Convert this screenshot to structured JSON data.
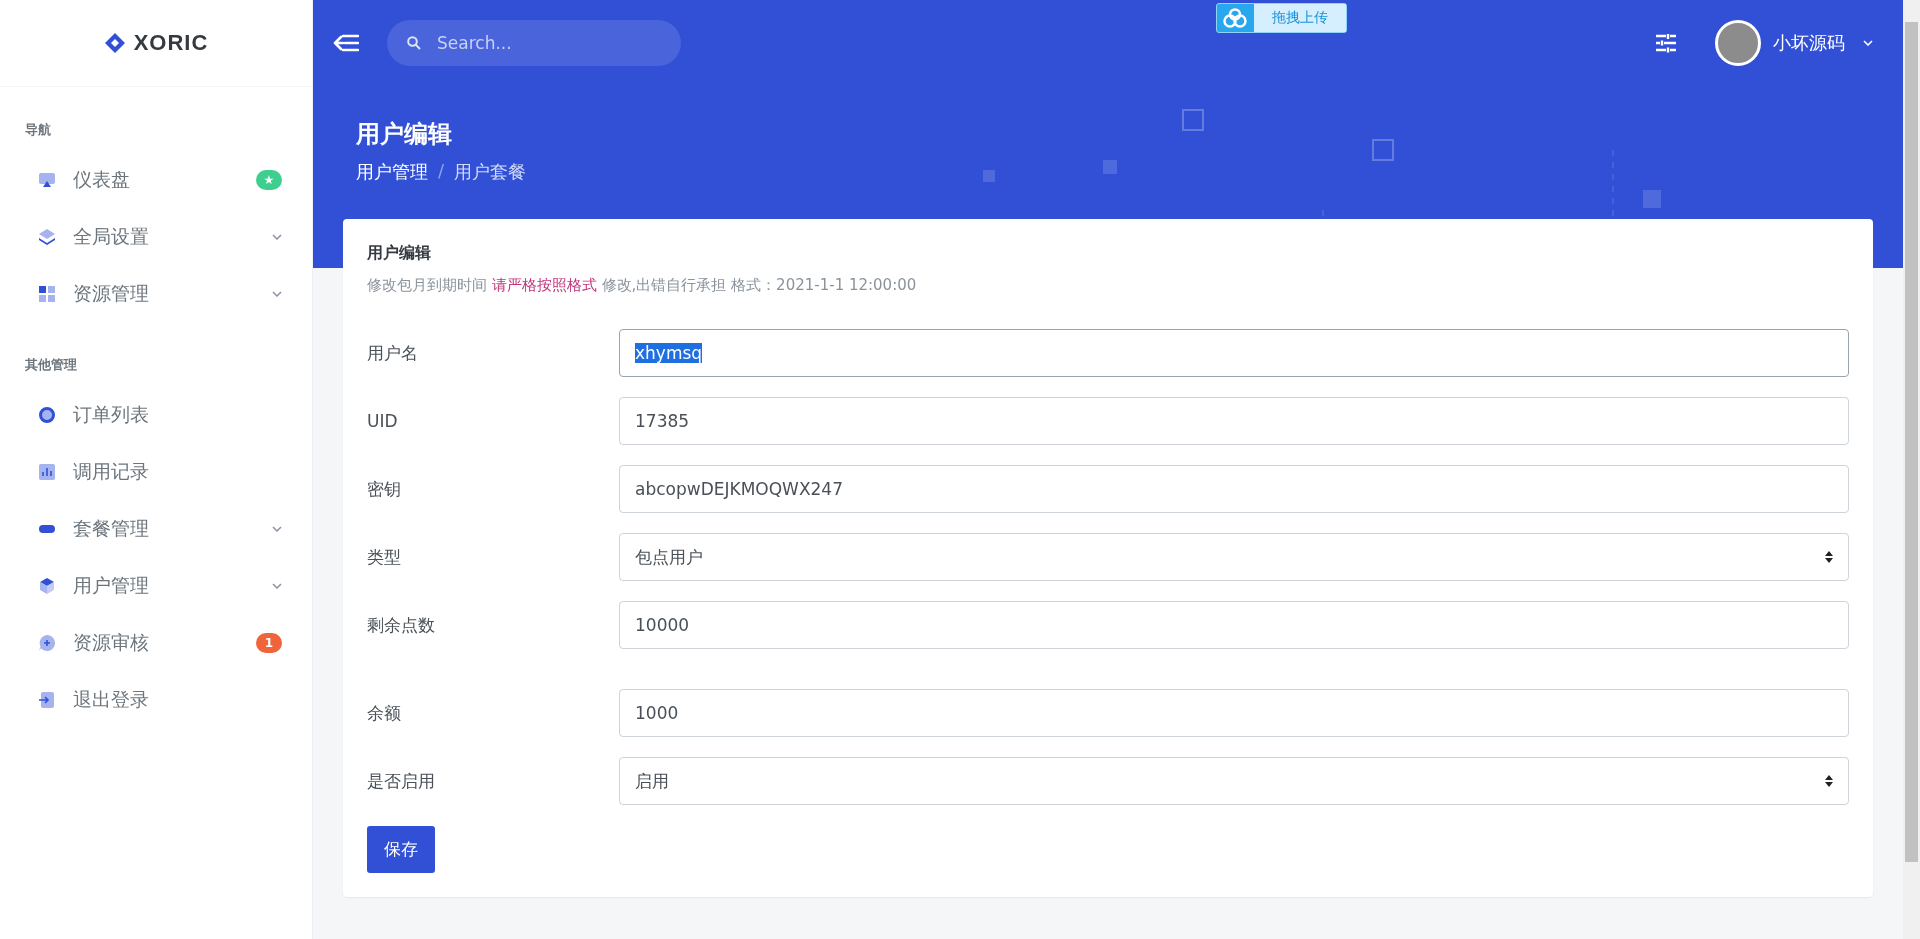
{
  "brand": {
    "name": "XORIC"
  },
  "sidebar": {
    "sections": [
      {
        "title": "导航",
        "items": [
          {
            "label": "仪表盘",
            "kind": "monitor",
            "badge": "★",
            "color": "#3ecf8e",
            "expandable": false
          },
          {
            "label": "全局设置",
            "kind": "layers",
            "expandable": true
          },
          {
            "label": "资源管理",
            "kind": "grid",
            "expandable": true
          }
        ]
      },
      {
        "title": "其他管理",
        "items": [
          {
            "label": "订单列表",
            "kind": "circle",
            "expandable": false
          },
          {
            "label": "调用记录",
            "kind": "chart",
            "expandable": false
          },
          {
            "label": "套餐管理",
            "kind": "pill",
            "expandable": true
          },
          {
            "label": "用户管理",
            "kind": "cube",
            "expandable": true
          },
          {
            "label": "资源审核",
            "kind": "chat",
            "badge": "1",
            "color": "#f0643b",
            "expandable": false
          },
          {
            "label": "退出登录",
            "kind": "exit",
            "expandable": false
          }
        ]
      }
    ]
  },
  "topbar": {
    "search": {
      "placeholder": "Search..."
    },
    "upload_button": "拖拽上传",
    "user": {
      "name": "小坏源码"
    }
  },
  "page": {
    "title": "用户编辑",
    "breadcrumb": [
      "用户管理",
      "用户套餐"
    ],
    "breadcrumb_separator": "/"
  },
  "card": {
    "title": "用户编辑",
    "description": {
      "before": "修改包月到期时间 ",
      "emphasis": "请严格按照格式",
      "after": " 修改,出错自行承担 格式：2021-1-1 12:00:00"
    },
    "fields": [
      {
        "label": "用户名",
        "kind": "text",
        "value": "xhymsq",
        "focused": true,
        "text_selected": true
      },
      {
        "label": "UID",
        "kind": "text",
        "value": "17385",
        "focused": false,
        "text_selected": false
      },
      {
        "label": "密钥",
        "kind": "text",
        "value": "abcopwDEJKMOQWX247",
        "focused": false,
        "text_selected": false
      },
      {
        "label": "类型",
        "kind": "select",
        "value": "包点用户",
        "focused": false,
        "text_selected": false
      },
      {
        "label": "剩余点数",
        "kind": "text",
        "value": "10000",
        "focused": false,
        "text_selected": false,
        "extra_gap": true
      },
      {
        "label": "余额",
        "kind": "text",
        "value": "1000",
        "focused": false,
        "text_selected": false
      },
      {
        "label": "是否启用",
        "kind": "select",
        "value": "启用",
        "focused": false,
        "text_selected": false
      }
    ],
    "submit": "保存"
  }
}
